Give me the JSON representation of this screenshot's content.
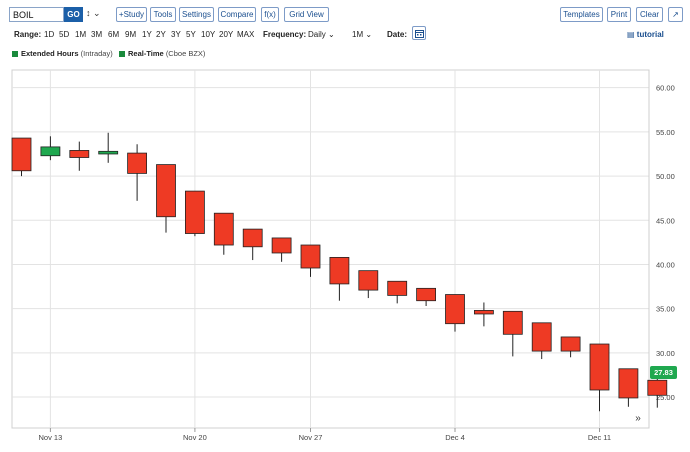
{
  "toolbar": {
    "symbol": "BOIL",
    "go_label": "GO",
    "compare_icon": "↕ ⌄",
    "study_label": "+Study",
    "tools_label": "Tools",
    "settings_label": "Settings",
    "compare_label": "Compare",
    "fx_label": "f(x)",
    "gridview_label": "Grid View",
    "templates_label": "Templates",
    "print_label": "Print",
    "clear_label": "Clear",
    "expand_icon": "↗"
  },
  "range_row": {
    "range_label": "Range:",
    "ranges": [
      "1D",
      "5D",
      "1M",
      "3M",
      "6M",
      "9M",
      "1Y",
      "2Y",
      "3Y",
      "5Y",
      "10Y",
      "20Y",
      "MAX"
    ],
    "frequency_label": "Frequency:",
    "frequency_value": "Daily",
    "interval_value": "1M",
    "date_label": "Date:",
    "tutorial_label": "tutorial"
  },
  "legend": {
    "extended_hours_label": "Extended Hours",
    "extended_hours_sub": "(Intraday)",
    "realtime_label": "Real-Time",
    "realtime_sub": "(Cboe BZX)",
    "marker_color": "#1a8a3c"
  },
  "last_price": "27.83",
  "scroll_icon": "»",
  "colors": {
    "down": "#ee3a24",
    "up": "#1fa84f",
    "grid": "#e3e3e3",
    "toolbar_text": "#1b4f8f",
    "go_button": "#1b5fa8"
  },
  "chart_data": {
    "type": "candlestick",
    "ylim": [
      21.5,
      62
    ],
    "yticks": [
      25,
      30,
      35,
      40,
      45,
      50,
      55,
      60
    ],
    "ytick_labels": [
      "25.00",
      "30.00",
      "35.00",
      "40.00",
      "45.00",
      "50.00",
      "55.00",
      "60.00"
    ],
    "xtick_labels": [
      "Nov 13",
      "Nov 20",
      "Nov 27",
      "Dec 4",
      "Dec 11"
    ],
    "xtick_index": [
      1,
      6,
      10,
      15,
      20
    ],
    "grid": true,
    "last_price": 27.83,
    "candles": [
      {
        "o": 54.3,
        "h": 54.3,
        "l": 50.0,
        "c": 50.6
      },
      {
        "o": 52.3,
        "h": 54.5,
        "l": 51.8,
        "c": 53.3
      },
      {
        "o": 52.9,
        "h": 53.9,
        "l": 50.6,
        "c": 52.1
      },
      {
        "o": 52.5,
        "h": 54.9,
        "l": 51.5,
        "c": 52.8
      },
      {
        "o": 52.6,
        "h": 53.6,
        "l": 47.2,
        "c": 50.3
      },
      {
        "o": 51.3,
        "h": 51.3,
        "l": 43.6,
        "c": 45.4
      },
      {
        "o": 48.3,
        "h": 48.3,
        "l": 43.2,
        "c": 43.5
      },
      {
        "o": 45.8,
        "h": 45.8,
        "l": 41.1,
        "c": 42.2
      },
      {
        "o": 44.0,
        "h": 44.0,
        "l": 40.5,
        "c": 42.0
      },
      {
        "o": 43.0,
        "h": 43.0,
        "l": 40.3,
        "c": 41.3
      },
      {
        "o": 42.2,
        "h": 42.2,
        "l": 38.6,
        "c": 39.6
      },
      {
        "o": 40.8,
        "h": 40.8,
        "l": 35.9,
        "c": 37.8
      },
      {
        "o": 39.3,
        "h": 39.3,
        "l": 36.2,
        "c": 37.1
      },
      {
        "o": 38.1,
        "h": 38.1,
        "l": 35.6,
        "c": 36.5
      },
      {
        "o": 37.3,
        "h": 37.3,
        "l": 35.3,
        "c": 35.9
      },
      {
        "o": 36.6,
        "h": 36.6,
        "l": 32.4,
        "c": 33.3
      },
      {
        "o": 34.8,
        "h": 35.7,
        "l": 33.0,
        "c": 34.4
      },
      {
        "o": 34.7,
        "h": 34.7,
        "l": 29.6,
        "c": 32.1
      },
      {
        "o": 33.4,
        "h": 33.4,
        "l": 29.3,
        "c": 30.2
      },
      {
        "o": 31.8,
        "h": 31.8,
        "l": 29.5,
        "c": 30.2
      },
      {
        "o": 31.0,
        "h": 31.0,
        "l": 23.4,
        "c": 25.8
      },
      {
        "o": 28.2,
        "h": 28.2,
        "l": 23.9,
        "c": 24.9
      },
      {
        "o": 26.9,
        "h": 27.3,
        "l": 23.8,
        "c": 25.2
      }
    ]
  }
}
